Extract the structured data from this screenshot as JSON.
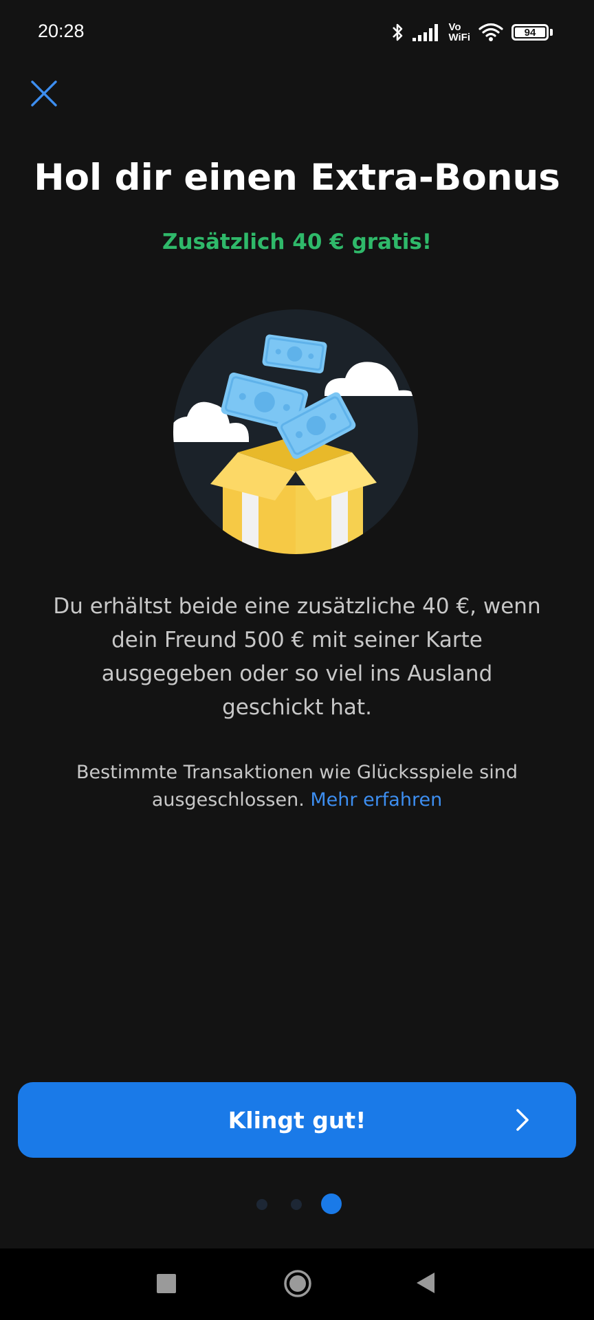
{
  "status_bar": {
    "time": "20:28",
    "vo_label": "Vo",
    "wifi_label": "WiFi",
    "battery_level": "94",
    "icons": [
      "bluetooth-icon",
      "signal-icon",
      "vowifi-icon",
      "wifi-icon",
      "battery-icon"
    ]
  },
  "header": {
    "close_icon": "close-icon",
    "title": "Hol dir einen Extra-Bonus",
    "subtitle": "Zusätzlich 40 € gratis!"
  },
  "illustration": {
    "icon": "gift-box-money-icon"
  },
  "body": {
    "description": "Du erhältst beide eine zusätzliche 40 €, wenn dein Freund 500 € mit seiner Karte ausgegeben oder so viel ins Ausland geschickt hat.",
    "note": "Bestimmte Transaktionen wie Glücksspiele sind ausgeschlossen.",
    "more_link": "Mehr erfahren"
  },
  "cta": {
    "label": "Klingt gut!",
    "icon": "chevron-right-icon"
  },
  "pagination": {
    "total": 3,
    "active_index": 3
  },
  "nav_bar": {
    "icons": [
      "recent-apps-icon",
      "home-icon",
      "back-icon"
    ]
  },
  "colors": {
    "background": "#131313",
    "accent": "#1a7ae8",
    "success": "#2fb96a",
    "link": "#3d8ef0"
  }
}
